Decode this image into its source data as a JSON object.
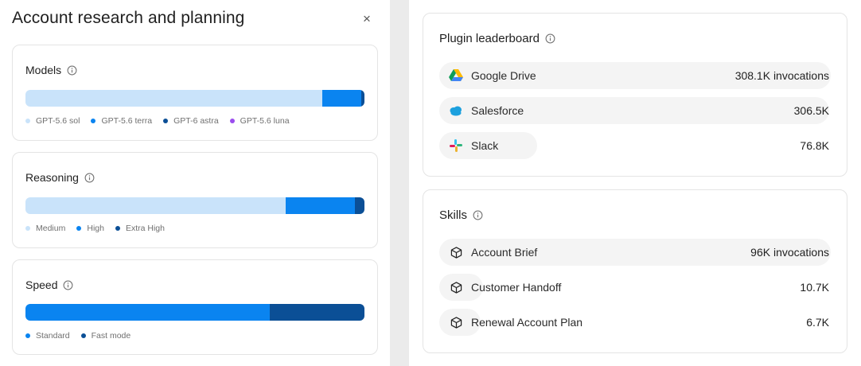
{
  "panel": {
    "title": "Account research and planning",
    "close_label": "×"
  },
  "models": {
    "title": "Models",
    "segments": [
      {
        "name": "GPT-5.6 sol",
        "share": 0.875,
        "color": "#c9e3fa"
      },
      {
        "name": "GPT-5.6 terra",
        "share": 0.115,
        "color": "#0a84f0"
      },
      {
        "name": "GPT-6 astra",
        "share": 0.01,
        "color": "#0b4f96"
      },
      {
        "name": "GPT-5.6 luna",
        "share": 0.0,
        "color": "#9b4dee"
      }
    ],
    "legend": [
      "GPT-5.6 sol",
      "GPT-5.6 terra",
      "GPT-6 astra",
      "GPT-5.6 luna"
    ]
  },
  "reasoning": {
    "title": "Reasoning",
    "segments": [
      {
        "name": "Medium",
        "share": 0.768,
        "color": "#c9e3fa"
      },
      {
        "name": "High",
        "share": 0.204,
        "color": "#0a84f0"
      },
      {
        "name": "Extra High",
        "share": 0.028,
        "color": "#0b4f96"
      }
    ],
    "legend": [
      "Medium",
      "High",
      "Extra High"
    ]
  },
  "speed": {
    "title": "Speed",
    "segments": [
      {
        "name": "Standard",
        "share": 0.72,
        "color": "#0a84f0"
      },
      {
        "name": "Fast mode",
        "share": 0.28,
        "color": "#0b4f96"
      }
    ],
    "legend": [
      "Standard",
      "Fast mode"
    ]
  },
  "plugins": {
    "title": "Plugin leaderboard",
    "items": [
      {
        "label": "Google Drive",
        "value": "308.1K invocations",
        "icon": "google-drive-icon",
        "share": 1.0
      },
      {
        "label": "Salesforce",
        "value": "306.5K",
        "icon": "salesforce-icon",
        "share": 0.995
      },
      {
        "label": "Slack",
        "value": "76.8K",
        "icon": "slack-icon",
        "share": 0.25
      }
    ]
  },
  "skills": {
    "title": "Skills",
    "items": [
      {
        "label": "Account Brief",
        "value": "96K invocations",
        "icon": "cube-icon",
        "share": 1.0
      },
      {
        "label": "Customer Handoff",
        "value": "10.7K",
        "icon": "cube-icon",
        "share": 0.111
      },
      {
        "label": "Renewal Account Plan",
        "value": "6.7K",
        "icon": "cube-icon",
        "share": 0.07
      }
    ]
  }
}
